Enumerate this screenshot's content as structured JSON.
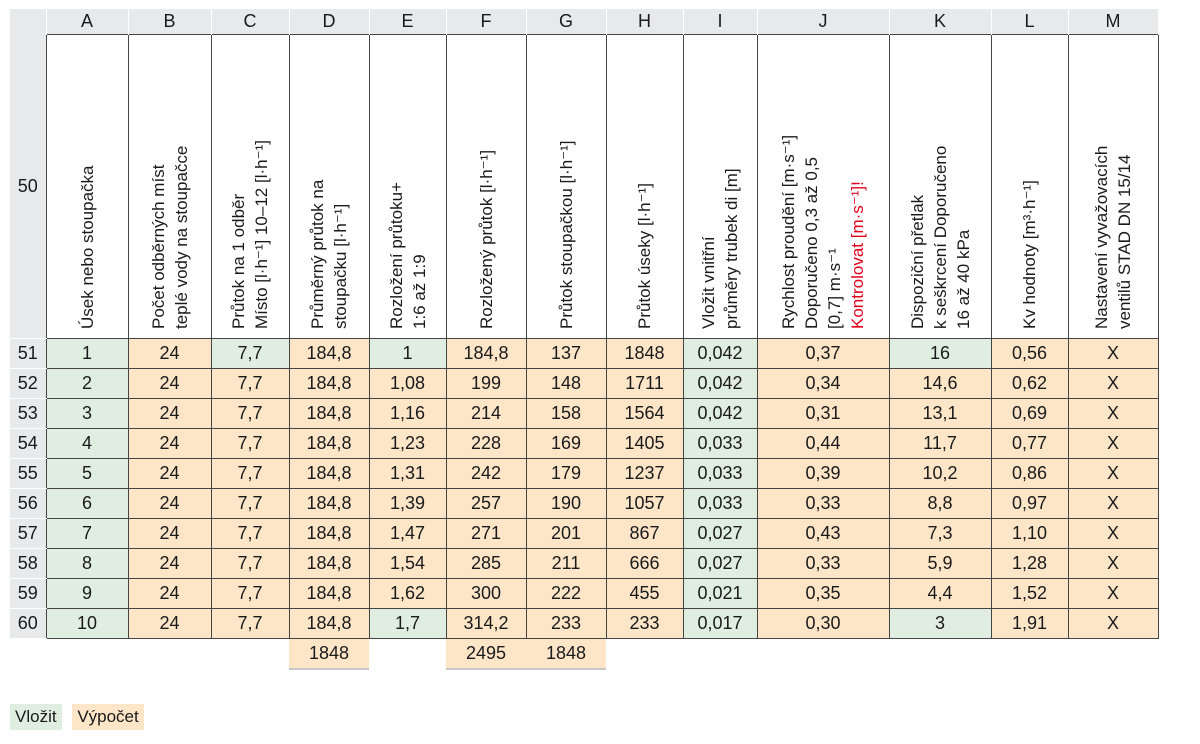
{
  "columns": [
    "A",
    "B",
    "C",
    "D",
    "E",
    "F",
    "G",
    "H",
    "I",
    "J",
    "K",
    "L",
    "M"
  ],
  "header_row_number": "50",
  "headers": [
    {
      "lines": [
        "Úsek nebo stoupačka"
      ]
    },
    {
      "lines": [
        "Počet odběrných míst",
        "teplé vody na stoupačce"
      ]
    },
    {
      "lines": [
        "Průtok na 1 odběr",
        "Místo [l·h⁻¹] 10–12 [l·h⁻¹]"
      ]
    },
    {
      "lines": [
        "Průměrný průtok na",
        "stoupačku [l·h⁻¹]"
      ]
    },
    {
      "lines": [
        "Rozložení průtoku+",
        "1:6 až 1:9"
      ]
    },
    {
      "lines": [
        "Rozložený průtok [l·h⁻¹]"
      ]
    },
    {
      "lines": [
        "Průtok stoupačkou [l·h⁻¹]"
      ]
    },
    {
      "lines": [
        "Průtok úseky [l·h⁻¹]"
      ]
    },
    {
      "lines": [
        "Vložit vnitřní",
        "průměry trubek di [m]"
      ]
    },
    {
      "lines": [
        "Rychlost proudění [m·s⁻¹]",
        "Doporučeno 0,3 až 0,5",
        "[0,7] m·s⁻¹"
      ],
      "warning": "Kontrolovat [m·s⁻¹]!"
    },
    {
      "lines": [
        "Dispoziční přetlak",
        "k seškrcení Doporučeno",
        "16 až 40 kPa"
      ]
    },
    {
      "lines": [
        "Kv hodnoty [m³·h⁻¹]"
      ]
    },
    {
      "lines": [
        "Nastavení vyvažovacích",
        "ventilů STAD DN 15/14"
      ]
    }
  ],
  "rows": [
    {
      "n": "51",
      "cells": [
        "1",
        "24",
        "7,7",
        "184,8",
        "1",
        "184,8",
        "137",
        "1848",
        "0,042",
        "0,37",
        "16",
        "0,56",
        "X"
      ],
      "styles": [
        "g",
        "o",
        "g",
        "o",
        "g",
        "o",
        "o",
        "o",
        "g",
        "o",
        "g",
        "o",
        "o"
      ]
    },
    {
      "n": "52",
      "cells": [
        "2",
        "24",
        "7,7",
        "184,8",
        "1,08",
        "199",
        "148",
        "1711",
        "0,042",
        "0,34",
        "14,6",
        "0,62",
        "X"
      ],
      "styles": [
        "g",
        "o",
        "o",
        "o",
        "o",
        "o",
        "o",
        "o",
        "g",
        "o",
        "o",
        "o",
        "o"
      ]
    },
    {
      "n": "53",
      "cells": [
        "3",
        "24",
        "7,7",
        "184,8",
        "1,16",
        "214",
        "158",
        "1564",
        "0,042",
        "0,31",
        "13,1",
        "0,69",
        "X"
      ],
      "styles": [
        "g",
        "o",
        "o",
        "o",
        "o",
        "o",
        "o",
        "o",
        "g",
        "o",
        "o",
        "o",
        "o"
      ]
    },
    {
      "n": "54",
      "cells": [
        "4",
        "24",
        "7,7",
        "184,8",
        "1,23",
        "228",
        "169",
        "1405",
        "0,033",
        "0,44",
        "11,7",
        "0,77",
        "X"
      ],
      "styles": [
        "g",
        "o",
        "o",
        "o",
        "o",
        "o",
        "o",
        "o",
        "g",
        "o",
        "o",
        "o",
        "o"
      ]
    },
    {
      "n": "55",
      "cells": [
        "5",
        "24",
        "7,7",
        "184,8",
        "1,31",
        "242",
        "179",
        "1237",
        "0,033",
        "0,39",
        "10,2",
        "0,86",
        "X"
      ],
      "styles": [
        "g",
        "o",
        "o",
        "o",
        "o",
        "o",
        "o",
        "o",
        "g",
        "o",
        "o",
        "o",
        "o"
      ]
    },
    {
      "n": "56",
      "cells": [
        "6",
        "24",
        "7,7",
        "184,8",
        "1,39",
        "257",
        "190",
        "1057",
        "0,033",
        "0,33",
        "8,8",
        "0,97",
        "X"
      ],
      "styles": [
        "g",
        "o",
        "o",
        "o",
        "o",
        "o",
        "o",
        "o",
        "g",
        "o",
        "o",
        "o",
        "o"
      ]
    },
    {
      "n": "57",
      "cells": [
        "7",
        "24",
        "7,7",
        "184,8",
        "1,47",
        "271",
        "201",
        "867",
        "0,027",
        "0,43",
        "7,3",
        "1,10",
        "X"
      ],
      "styles": [
        "g",
        "o",
        "o",
        "o",
        "o",
        "o",
        "o",
        "o",
        "g",
        "o",
        "o",
        "o",
        "o"
      ]
    },
    {
      "n": "58",
      "cells": [
        "8",
        "24",
        "7,7",
        "184,8",
        "1,54",
        "285",
        "211",
        "666",
        "0,027",
        "0,33",
        "5,9",
        "1,28",
        "X"
      ],
      "styles": [
        "g",
        "o",
        "o",
        "o",
        "o",
        "o",
        "o",
        "o",
        "g",
        "o",
        "o",
        "o",
        "o"
      ]
    },
    {
      "n": "59",
      "cells": [
        "9",
        "24",
        "7,7",
        "184,8",
        "1,62",
        "300",
        "222",
        "455",
        "0,021",
        "0,35",
        "4,4",
        "1,52",
        "X"
      ],
      "styles": [
        "g",
        "o",
        "o",
        "o",
        "o",
        "o",
        "o",
        "o",
        "g",
        "o",
        "o",
        "o",
        "o"
      ]
    },
    {
      "n": "60",
      "cells": [
        "10",
        "24",
        "7,7",
        "184,8",
        "1,7",
        "314,2",
        "233",
        "233",
        "0,017",
        "0,30",
        "3",
        "1,91",
        "X"
      ],
      "styles": [
        "g",
        "o",
        "o",
        "o",
        "g",
        "o",
        "o",
        "o",
        "g",
        "o",
        "g",
        "o",
        "o"
      ]
    }
  ],
  "totals": {
    "D": "1848",
    "F": "2495",
    "G": "1848"
  },
  "legend": {
    "insert": "Vložit",
    "calc": "Výpočet"
  }
}
